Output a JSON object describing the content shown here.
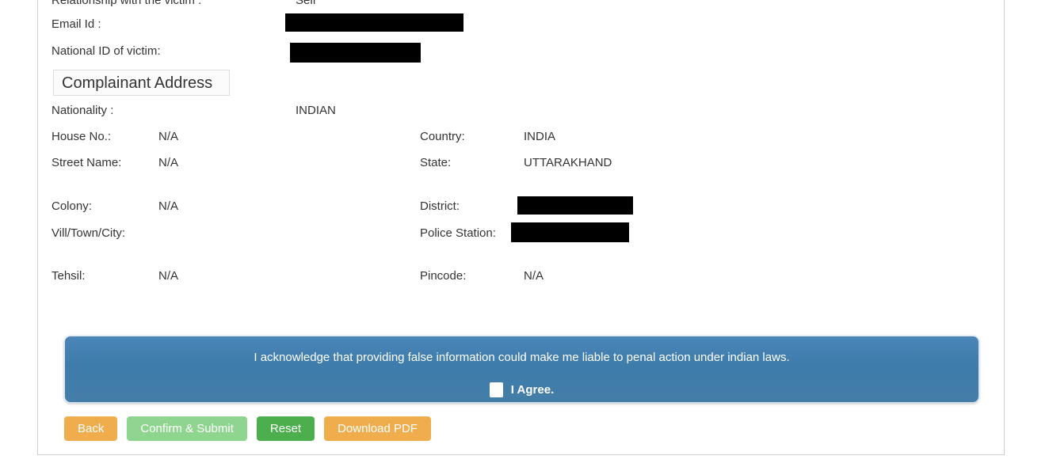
{
  "form": {
    "top_fields": [
      {
        "label": "Relationship with the victim :",
        "value": "Self",
        "redacted": false
      },
      {
        "label": "Email Id :",
        "value": "",
        "redacted": true
      },
      {
        "label": "National ID of victim:",
        "value": "",
        "redacted": true
      }
    ],
    "section_title": "Complainant Address",
    "nationality": {
      "label": "Nationality :",
      "value": "INDIAN"
    },
    "address_left": [
      {
        "label": "House No.:",
        "value": "N/A"
      },
      {
        "label": "Street Name:",
        "value": "N/A"
      },
      {
        "label": "Colony:",
        "value": "N/A"
      },
      {
        "label": "Vill/Town/City:",
        "value": ""
      },
      {
        "label": "Tehsil:",
        "value": "N/A"
      }
    ],
    "address_right": [
      {
        "label": "Country:",
        "value": "INDIA",
        "redacted": false
      },
      {
        "label": "State:",
        "value": "UTTARAKHAND",
        "redacted": false
      },
      {
        "label": "District:",
        "value": "",
        "redacted": true
      },
      {
        "label": "Police Station:",
        "value": "",
        "redacted": true
      },
      {
        "label": "Pincode:",
        "value": "N/A",
        "redacted": false
      }
    ]
  },
  "acknowledgement": {
    "text": "I acknowledge that providing false information could make me liable to penal action under indian laws.",
    "agree_label": "I Agree.",
    "checked": false,
    "background_color": "#3e7cab"
  },
  "buttons": {
    "back": "Back",
    "confirm_submit": "Confirm & Submit",
    "reset": "Reset",
    "download_pdf": "Download PDF",
    "orange_color": "#f0ad4e",
    "green_color": "#4cae4c",
    "disabled_green_color": "#8fd48f"
  }
}
